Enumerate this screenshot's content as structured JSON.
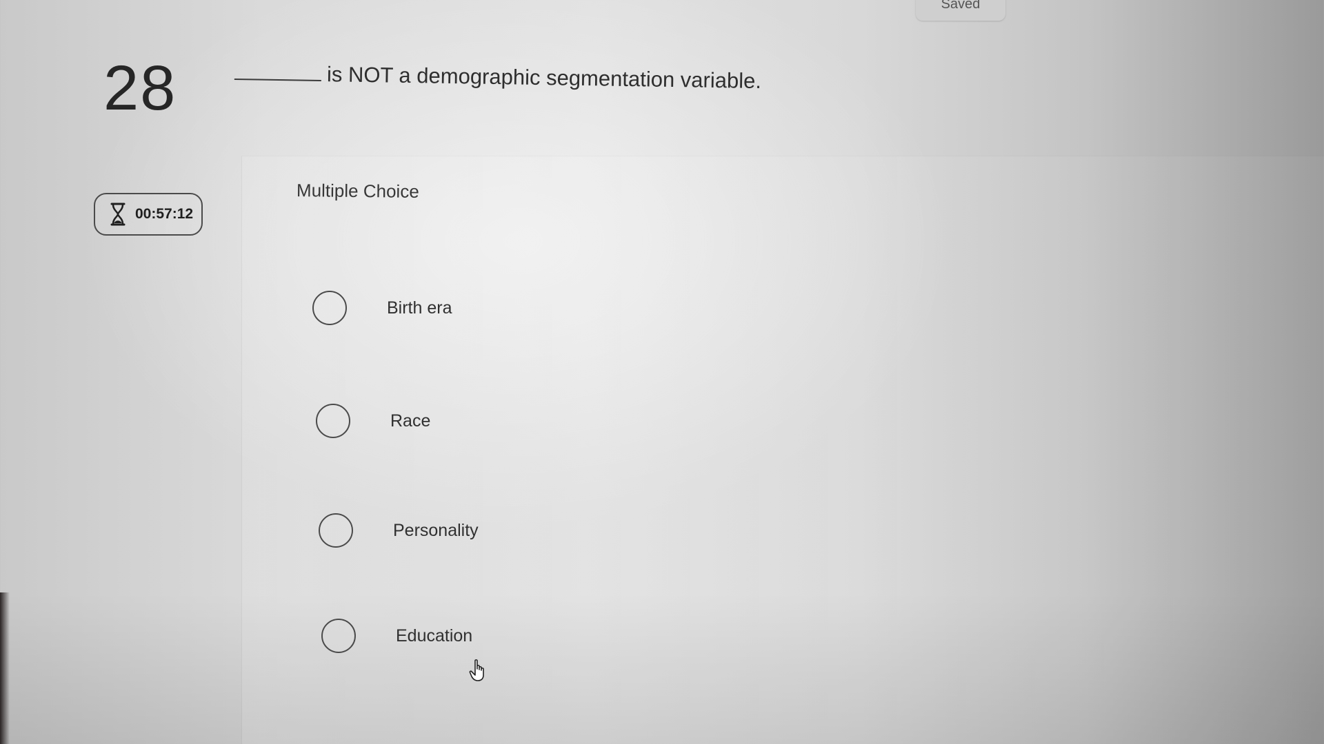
{
  "header": {
    "saved_label": "Saved"
  },
  "question": {
    "number": "28",
    "text": "is NOT a demographic segmentation variable."
  },
  "timer": {
    "icon": "hourglass-icon",
    "value": "00:57:12"
  },
  "answer_area": {
    "type_label": "Multiple Choice",
    "options": [
      {
        "label": "Birth era",
        "selected": false
      },
      {
        "label": "Race",
        "selected": false
      },
      {
        "label": "Personality",
        "selected": false
      },
      {
        "label": "Education",
        "selected": false
      }
    ]
  },
  "cursor": {
    "icon": "hand-pointer-icon"
  }
}
